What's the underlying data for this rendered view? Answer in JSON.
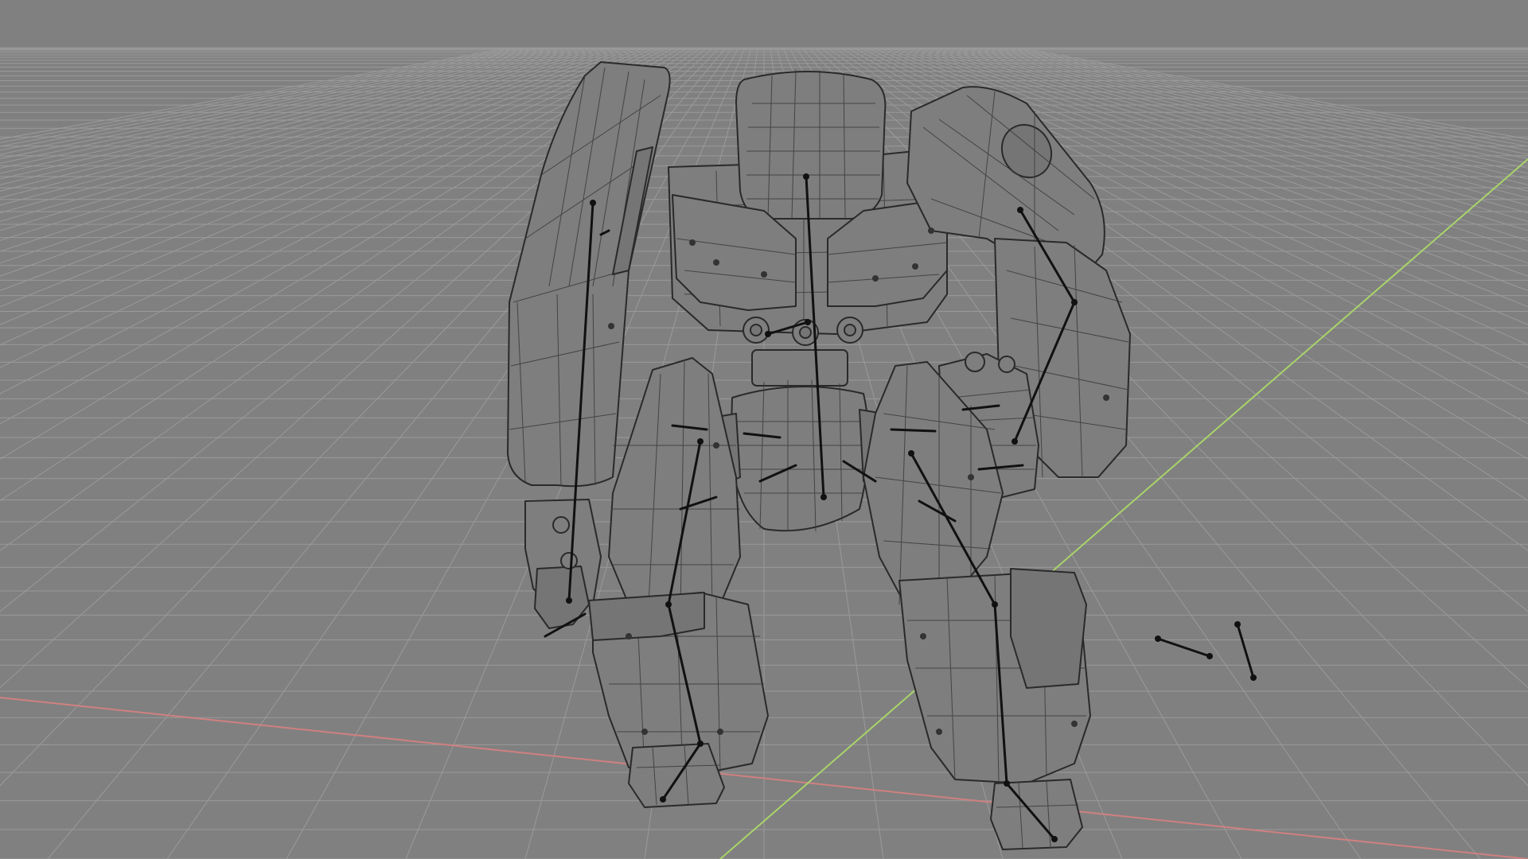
{
  "viewport": {
    "mode": "wireframe",
    "background_color": "#808080",
    "grid_color": "#9a9a9a",
    "x_axis_color": "#d08080",
    "y_axis_color": "#a9d46a",
    "wire_color": "#2a2a2a",
    "bone_color": "#111111"
  },
  "scene": {
    "objects": [
      {
        "name": "robot-mesh",
        "icon": "mech-robot-icon"
      },
      {
        "name": "armature",
        "icon": "bone-icon"
      }
    ]
  }
}
